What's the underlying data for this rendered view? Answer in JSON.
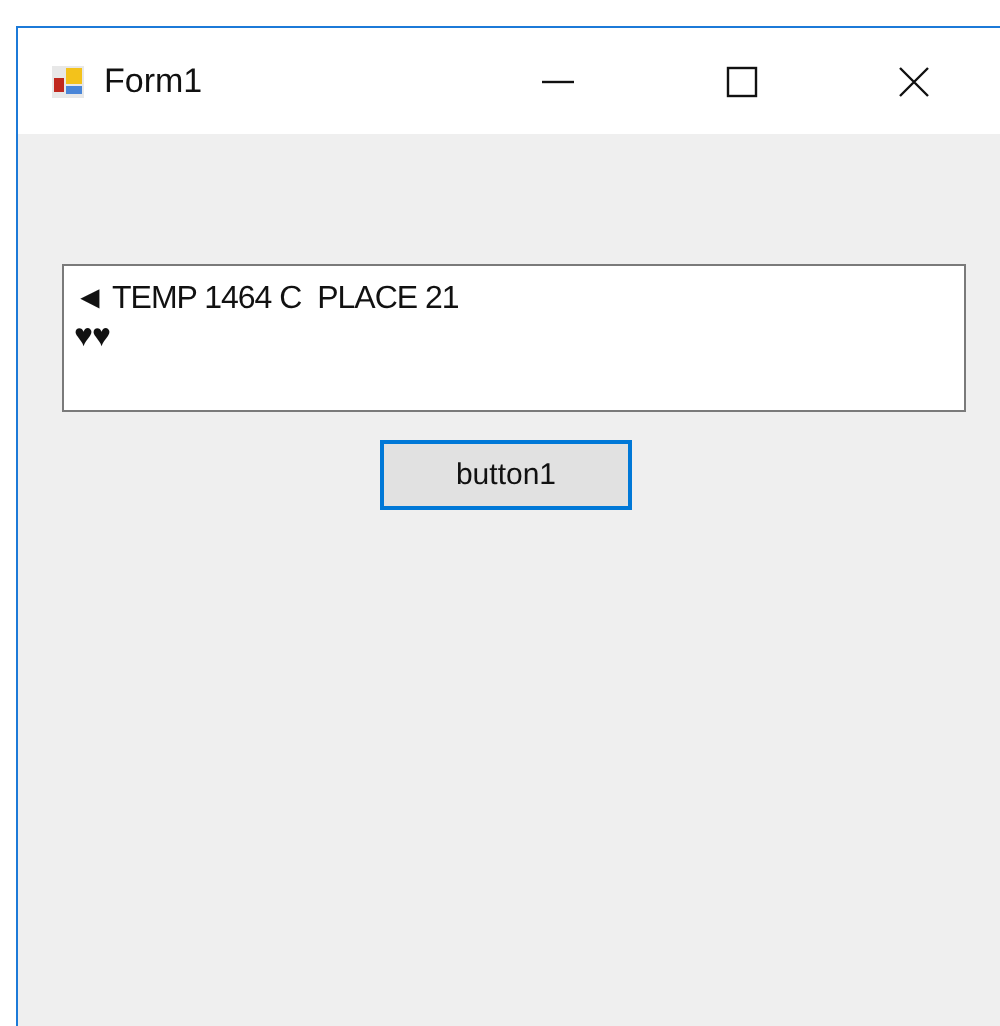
{
  "window": {
    "title": "Form1"
  },
  "textbox": {
    "lines": [
      "◄ TEMP 1464 C  PLACE 21",
      "♥♥"
    ]
  },
  "button": {
    "label": "button1",
    "focused": true
  }
}
